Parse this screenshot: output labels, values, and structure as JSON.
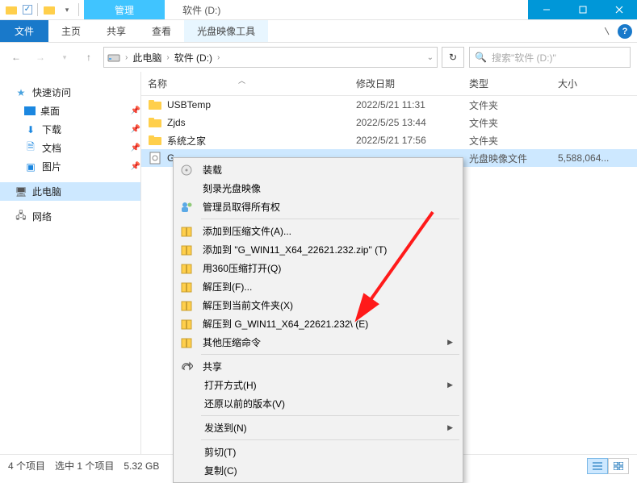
{
  "titlebar": {
    "context_tab": "管理",
    "app_title": "软件 (D:)"
  },
  "ribbon": {
    "file": "文件",
    "tabs": [
      "主页",
      "共享",
      "查看",
      "光盘映像工具"
    ]
  },
  "address": {
    "root": "此电脑",
    "current": "软件 (D:)",
    "search_placeholder": "搜索\"软件 (D:)\""
  },
  "sidebar": {
    "quick_access": "快速访问",
    "items": [
      "桌面",
      "下载",
      "文档",
      "图片"
    ],
    "this_pc": "此电脑",
    "network": "网络"
  },
  "columns": {
    "name": "名称",
    "date": "修改日期",
    "type": "类型",
    "size": "大小"
  },
  "rows": [
    {
      "name": "USBTemp",
      "date": "2022/5/21 11:31",
      "type": "文件夹",
      "size": "",
      "kind": "folder"
    },
    {
      "name": "Zjds",
      "date": "2022/5/25 13:44",
      "type": "文件夹",
      "size": "",
      "kind": "folder"
    },
    {
      "name": "系统之家",
      "date": "2022/5/21 17:56",
      "type": "文件夹",
      "size": "",
      "kind": "folder"
    },
    {
      "name": "G_",
      "date": "",
      "type": "光盘映像文件",
      "size": "5,588,064...",
      "kind": "iso",
      "selected": true
    }
  ],
  "context_menu": {
    "items": [
      {
        "label": "装载",
        "icon": "disc-icon"
      },
      {
        "label": "刻录光盘映像",
        "icon": ""
      },
      {
        "label": "管理员取得所有权",
        "icon": "admin-icon"
      },
      {
        "sep": true
      },
      {
        "label": "添加到压缩文件(A)...",
        "icon": "archive-icon"
      },
      {
        "label": "添加到 \"G_WIN11_X64_22621.232.zip\" (T)",
        "icon": "archive-icon"
      },
      {
        "label": "用360压缩打开(Q)",
        "icon": "archive-icon"
      },
      {
        "label": "解压到(F)...",
        "icon": "archive-icon"
      },
      {
        "label": "解压到当前文件夹(X)",
        "icon": "archive-icon"
      },
      {
        "label": "解压到 G_WIN11_X64_22621.232\\ (E)",
        "icon": "archive-icon"
      },
      {
        "label": "其他压缩命令",
        "icon": "archive-icon",
        "submenu": true
      },
      {
        "sep": true
      },
      {
        "label": "共享",
        "icon": "share-icon"
      },
      {
        "label": "打开方式(H)",
        "indent": true,
        "submenu": true
      },
      {
        "label": "还原以前的版本(V)",
        "indent": true
      },
      {
        "sep": true
      },
      {
        "label": "发送到(N)",
        "indent": true,
        "submenu": true
      },
      {
        "sep": true
      },
      {
        "label": "剪切(T)",
        "indent": true
      },
      {
        "label": "复制(C)",
        "indent": true
      }
    ]
  },
  "statusbar": {
    "count": "4 个项目",
    "selection": "选中 1 个项目",
    "size": "5.32 GB"
  }
}
